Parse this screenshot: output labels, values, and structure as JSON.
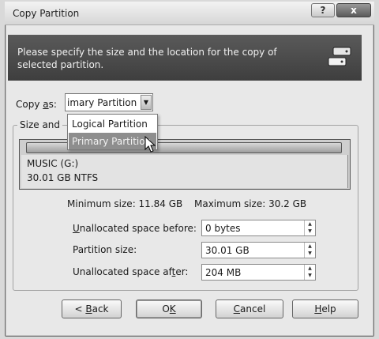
{
  "window": {
    "title": "Copy Partition",
    "help_label": "?",
    "close_label": "x"
  },
  "banner": {
    "text": "Please specify the size and the location for the copy of selected partition.",
    "icon": "drives-copy-icon"
  },
  "copy_as": {
    "label_pre": "Copy ",
    "label_key": "a",
    "label_post": "s:",
    "selected": "imary Partition",
    "options": [
      "Logical Partition",
      "Primary Partition"
    ]
  },
  "group": {
    "legend": "Size and"
  },
  "partition": {
    "name": "MUSIC (G:)",
    "info": "30.01 GB  NTFS"
  },
  "sizes": {
    "minimum": "Minimum size: 11.84 GB",
    "maximum": "Maximum size: 30.2 GB"
  },
  "fields": [
    {
      "key": "U",
      "rest": "nallocated space before:",
      "value": "0 bytes"
    },
    {
      "key": "",
      "rest": "Partition size:",
      "value": "30.01 GB"
    },
    {
      "key": "",
      "rest": "Unallocated space af",
      "key2": "t",
      "rest2": "er:",
      "value": "204 MB"
    }
  ],
  "buttons": {
    "back": {
      "pre": "< ",
      "key": "B",
      "rest": "ack"
    },
    "ok": {
      "pre": "O",
      "key": "K",
      "rest": ""
    },
    "cancel": {
      "pre": "",
      "key": "C",
      "rest": "ancel"
    },
    "help": {
      "pre": "",
      "key": "H",
      "rest": "elp"
    }
  }
}
